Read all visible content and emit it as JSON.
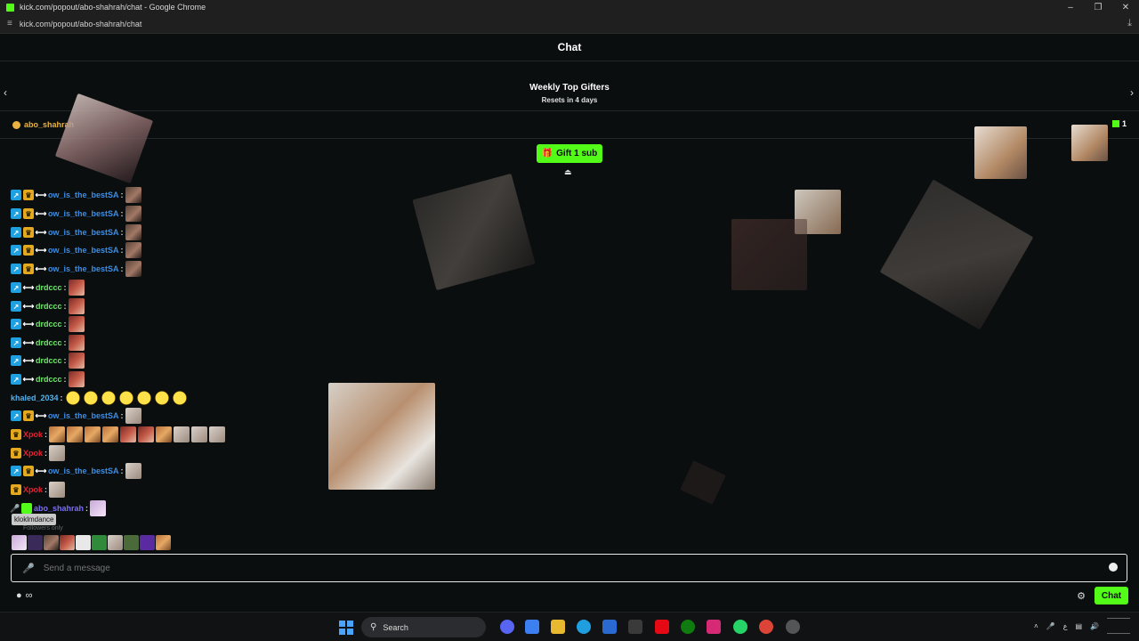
{
  "browser": {
    "window_title": "kick.com/popout/abo-shahrah/chat - Google Chrome",
    "url": "kick.com/popout/abo-shahrah/chat"
  },
  "chat": {
    "header_title": "Chat",
    "gifters_title": "Weekly Top Gifters",
    "gifters_subtitle": "Resets in 4 days",
    "pinned_user": "abo_shahrah",
    "sub_count": "1",
    "gift_button": "Gift 1 sub",
    "messages": [
      {
        "user": "ow_is_the_bestSA",
        "color": "#3b8ee6"
      },
      {
        "user": "ow_is_the_bestSA",
        "color": "#3b8ee6"
      },
      {
        "user": "ow_is_the_bestSA",
        "color": "#3b8ee6"
      },
      {
        "user": "ow_is_the_bestSA",
        "color": "#3b8ee6"
      },
      {
        "user": "ow_is_the_bestSA",
        "color": "#3b8ee6"
      },
      {
        "user": "drdccc",
        "color": "#6ee86a"
      },
      {
        "user": "drdccc",
        "color": "#6ee86a"
      },
      {
        "user": "drdccc",
        "color": "#6ee86a"
      },
      {
        "user": "drdccc",
        "color": "#6ee86a"
      },
      {
        "user": "drdccc",
        "color": "#6ee86a"
      },
      {
        "user": "drdccc",
        "color": "#6ee86a"
      },
      {
        "user": "khaled_2034",
        "color": "#4fb3f0"
      },
      {
        "user": "ow_is_the_bestSA",
        "color": "#3b8ee6"
      },
      {
        "user": "Xpok",
        "color": "#e02434"
      },
      {
        "user": "Xpok",
        "color": "#e02434"
      },
      {
        "user": "ow_is_the_bestSA",
        "color": "#3b8ee6"
      },
      {
        "user": "Xpok",
        "color": "#e02434"
      },
      {
        "user": "abo_shahrah",
        "color": "#7a6ef7"
      }
    ],
    "tooltip": "kloklmdance",
    "followers_label": "Followers only",
    "input_placeholder": "Send a message",
    "chat_button": "Chat"
  },
  "taskbar": {
    "search_label": "Search"
  },
  "icons": [
    "kick-favicon",
    "minimize-icon",
    "maximize-icon",
    "close-icon",
    "tune-icon",
    "download-icon",
    "chevron-left-icon",
    "chevron-right-icon",
    "gift-icon",
    "collapse-icon",
    "mic-icon",
    "emoji-icon",
    "settings-icon",
    "windows-start-icon",
    "search-icon"
  ],
  "accent_color": "#53fc18"
}
